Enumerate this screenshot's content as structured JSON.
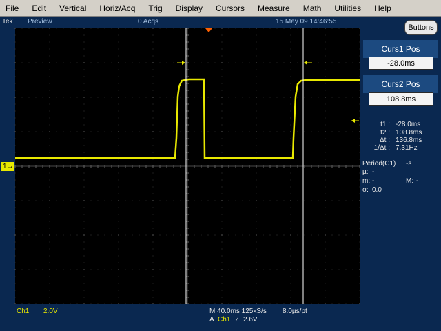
{
  "menu": [
    "File",
    "Edit",
    "Vertical",
    "Horiz/Acq",
    "Trig",
    "Display",
    "Cursors",
    "Measure",
    "Math",
    "Utilities",
    "Help"
  ],
  "status": {
    "brand": "Tek",
    "mode": "Preview",
    "acqs": "0 Acqs",
    "datetime": "15 May 09 14:46:55"
  },
  "buttons_label": "Buttons",
  "cursors": {
    "curs1_label": "Curs1 Pos",
    "curs1_value": "-28.0ms",
    "curs2_label": "Curs2 Pos",
    "curs2_value": "108.8ms"
  },
  "readout": {
    "t1_label": "t1 :",
    "t1_value": "-28.0ms",
    "t2_label": "t2 :",
    "t2_value": "108.8ms",
    "dt_label": "Δt :",
    "dt_value": "136.8ms",
    "inv_label": "1/Δt :",
    "inv_value": "7.31Hz"
  },
  "measurement": {
    "title": "Period(C1)",
    "title_value": "-s",
    "mu_label": "µ:",
    "mu_value": "-",
    "m_label": "m:",
    "m_value": "-",
    "M_label": "M:",
    "M_value": "-",
    "sigma_label": "σ:",
    "sigma_value": "0.0"
  },
  "channel_marker": "1",
  "bottom": {
    "ch": "Ch1",
    "volts_div": "2.0V",
    "timebase": "M 40.0ms 125kS/s",
    "per_pt": "8.0µs/pt",
    "trigger_prefix": "A",
    "trigger_ch": "Ch1",
    "trigger_slope": "⌿",
    "trigger_level": "2.6V"
  },
  "colors": {
    "trace": "#e8e800",
    "background": "#0a2850",
    "screen": "#000000",
    "trigger_marker": "#ff6000"
  }
}
